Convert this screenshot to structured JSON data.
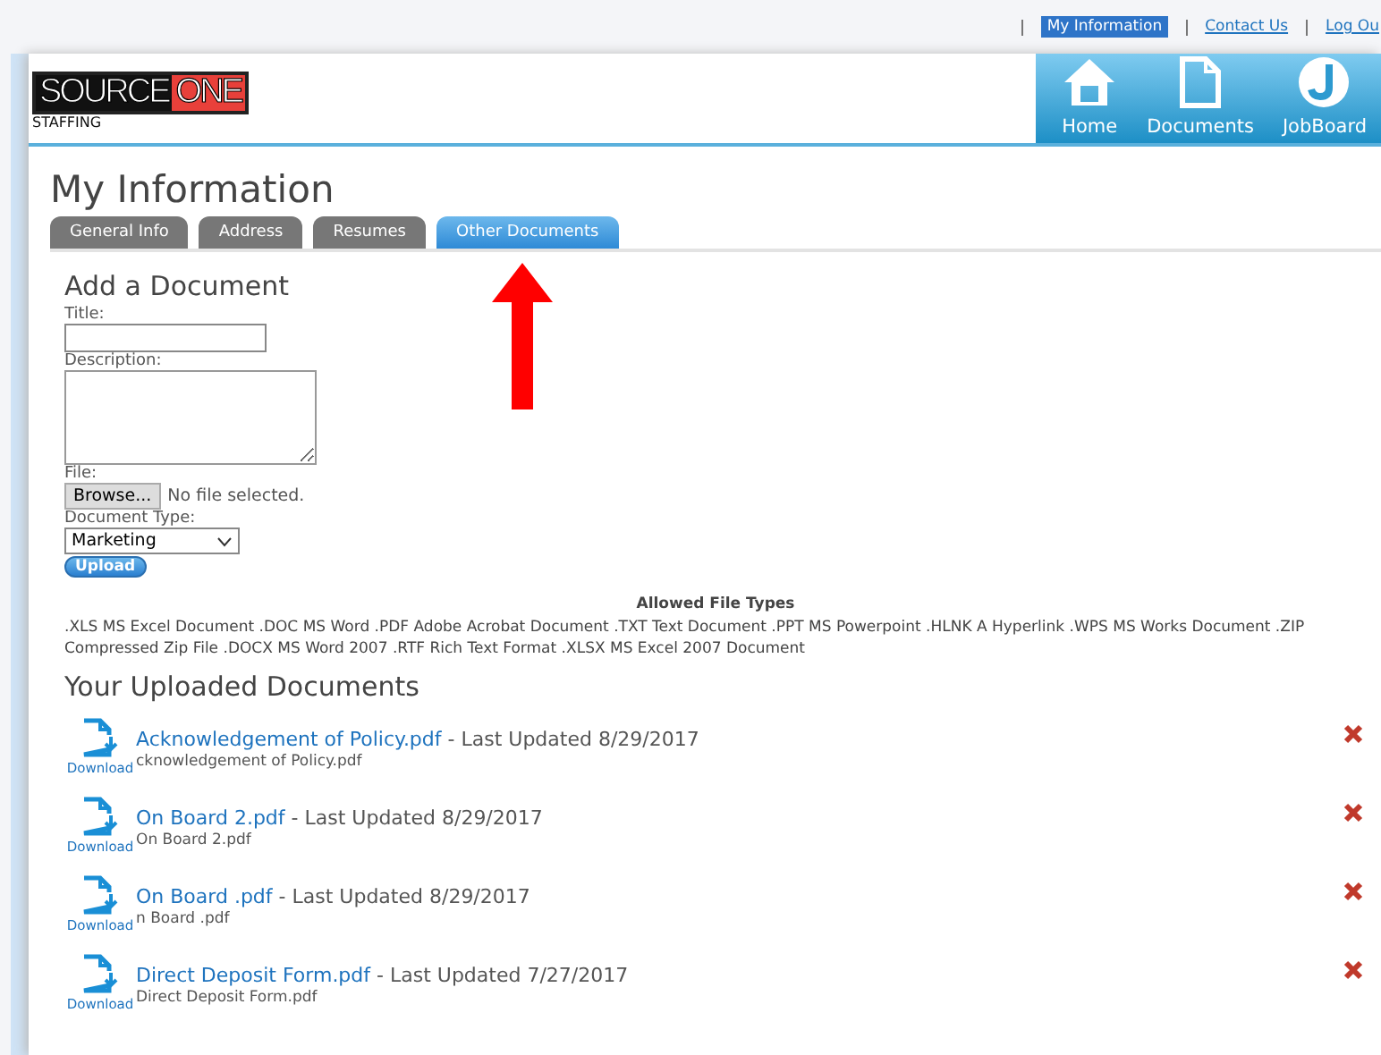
{
  "top_links": [
    {
      "label": "My Information",
      "selected": true
    },
    {
      "label": "Contact Us",
      "selected": false
    },
    {
      "label": "Log Ou",
      "selected": false
    }
  ],
  "logo": {
    "word_1": "SOURCE",
    "word_2": "ONE",
    "tagline": "STAFFING"
  },
  "nav": [
    {
      "label": "Home",
      "kind": "home"
    },
    {
      "label": "Documents",
      "kind": "document"
    },
    {
      "label": "JobBoard",
      "kind": "jobboard"
    }
  ],
  "page_title": "My Information",
  "tabs": [
    {
      "label": "General Info",
      "selected": false
    },
    {
      "label": "Address",
      "selected": false
    },
    {
      "label": "Resumes",
      "selected": false
    },
    {
      "label": "Other Documents",
      "selected": true
    }
  ],
  "form": {
    "heading": "Add a Document",
    "title_label": "Title:",
    "description_label": "Description:",
    "file_label": "File:",
    "browse_button": "Browse...",
    "file_status": "No file selected.",
    "type_label": "Document Type:",
    "type_value": "Marketing",
    "upload_button": "Upload"
  },
  "allowed": {
    "heading": "Allowed File Types",
    "text": ".XLS MS Excel Document .DOC MS Word .PDF Adobe Acrobat Document .TXT Text Document .PPT MS Powerpoint .HLNK A Hyperlink .WPS MS Works Document .ZIP Compressed Zip File .DOCX MS Word 2007 .RTF Rich Text Format .XLSX MS Excel 2007 Document"
  },
  "uploaded_heading": "Your Uploaded Documents",
  "documents": [
    {
      "download": "Download",
      "name": "Acknowledgement of Policy.pdf",
      "updated": " - Last Updated 8/29/2017",
      "description": "cknowledgement of Policy.pdf"
    },
    {
      "download": "Download",
      "name": "On Board 2.pdf",
      "updated": " - Last Updated 8/29/2017",
      "description": "On Board 2.pdf"
    },
    {
      "download": "Download",
      "name": "On Board .pdf",
      "updated": " - Last Updated 8/29/2017",
      "description": "n Board .pdf"
    },
    {
      "download": "Download",
      "name": "Direct Deposit Form.pdf",
      "updated": " - Last Updated 7/27/2017",
      "description": "Direct Deposit Form.pdf"
    }
  ]
}
